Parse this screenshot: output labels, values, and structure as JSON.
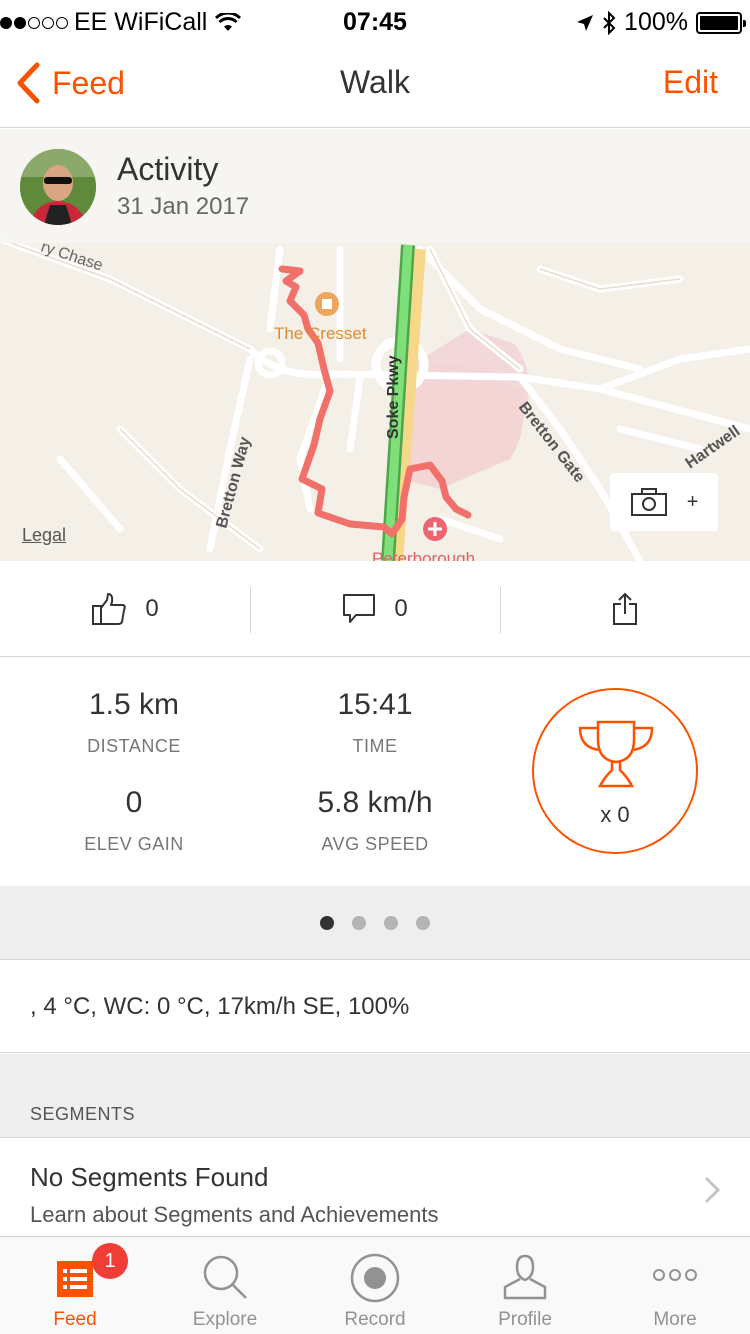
{
  "status_bar": {
    "carrier": "EE WiFiCall",
    "time": "07:45",
    "battery": "100%",
    "signal_bars_filled": 2,
    "signal_bars_total": 5
  },
  "nav": {
    "back_label": "Feed",
    "title": "Walk",
    "edit_label": "Edit"
  },
  "activity": {
    "name": "Activity",
    "date": "31 Jan 2017"
  },
  "map": {
    "legal_label": "Legal",
    "photo_add_label": "+",
    "labels": {
      "chase": "ry Chase",
      "place": "The Cresset",
      "road_soke": "Soke Pkwy",
      "road_bretton_way": "Bretton Way",
      "road_bretton_gate": "Bretton Gate",
      "road_hartwell": "Hartwell",
      "hospital": "Peterborough"
    },
    "colors": {
      "route": "#f2706a",
      "parkway": "#6fd26a",
      "land": "#f4efe7",
      "hospital_area": "#f4d6d6"
    }
  },
  "social": {
    "kudos_count": "0",
    "comments_count": "0"
  },
  "stats": {
    "distance_value": "1.5 km",
    "distance_label": "DISTANCE",
    "time_value": "15:41",
    "time_label": "TIME",
    "elev_value": "0",
    "elev_label": "ELEV GAIN",
    "speed_value": "5.8 km/h",
    "speed_label": "AVG SPEED",
    "trophy_count": "x 0"
  },
  "pager": {
    "total": 4,
    "active_index": 0
  },
  "weather": {
    "text": ", 4 °C, WC: 0 °C, 17km/h SE, 100%"
  },
  "segments": {
    "header": "SEGMENTS",
    "title": "No Segments Found",
    "subtitle": "Learn about Segments and Achievements"
  },
  "tabs": [
    {
      "label": "Feed",
      "icon": "feed-icon",
      "active": true,
      "badge": "1"
    },
    {
      "label": "Explore",
      "icon": "search-icon",
      "active": false
    },
    {
      "label": "Record",
      "icon": "record-icon",
      "active": false
    },
    {
      "label": "Profile",
      "icon": "profile-icon",
      "active": false
    },
    {
      "label": "More",
      "icon": "more-icon",
      "active": false
    }
  ],
  "colors": {
    "accent": "#fc5200",
    "badge": "#ef3e36"
  }
}
